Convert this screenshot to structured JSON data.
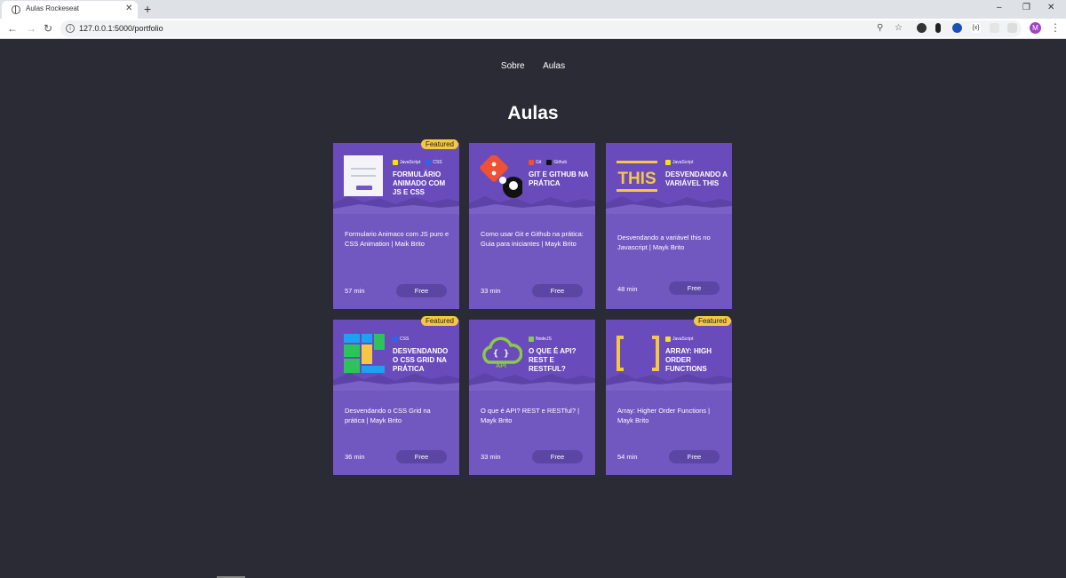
{
  "browser": {
    "tab_title": "Aulas Rockeseat",
    "url": "127.0.0.1:5000/portfolio",
    "avatar_letter": "M",
    "window_controls": [
      "–",
      "❐",
      "✕"
    ]
  },
  "nav": {
    "links": [
      "Sobre",
      "Aulas"
    ]
  },
  "page_title": "Aulas",
  "colors": {
    "background": "#2a2b35",
    "card": "#7157c0",
    "thumb": "#6a4bbb",
    "badge": "#f5c843",
    "price_pill": "#5b46a4"
  },
  "cards": [
    {
      "featured": "Featured",
      "tags": [
        {
          "label": "JavaScript",
          "color": "#f7df1e"
        },
        {
          "label": "CSS",
          "color": "#2965f1"
        }
      ],
      "thumb_title": "Formulário animado com JS e CSS",
      "art": "form",
      "description": "Formulario Animaco com JS puro e CSS Animation | Maik Brito",
      "duration": "57 min",
      "price": "Free"
    },
    {
      "featured": "",
      "tags": [
        {
          "label": "Git",
          "color": "#f05033"
        },
        {
          "label": "Github",
          "color": "#111111"
        }
      ],
      "thumb_title": "Git e Github na prática",
      "art": "git",
      "description": "Como usar Git e Github na prática: Guia para iniciantes | Mayk Brito",
      "duration": "33 min",
      "price": "Free"
    },
    {
      "featured": "",
      "tags": [
        {
          "label": "JavaScript",
          "color": "#f7df1e"
        }
      ],
      "thumb_title": "Desvendando a variável this",
      "art": "this",
      "description": "Desvendando a variável this no Javascript | Mayk Brito",
      "duration": "48 min",
      "price": "Free"
    },
    {
      "featured": "Featured",
      "tags": [
        {
          "label": "CSS",
          "color": "#2965f1"
        }
      ],
      "thumb_title": "Desvendando o CSS Grid na prática",
      "art": "grid",
      "description": "Desvendando o CSS Grid na prática | Mayk Brito",
      "duration": "36 min",
      "price": "Free"
    },
    {
      "featured": "",
      "tags": [
        {
          "label": "NodeJS",
          "color": "#8cc84b"
        }
      ],
      "thumb_title": "O que é API? REST e RESTful?",
      "art": "api",
      "description": "O que é API? REST e RESTful? | Mayk Brito",
      "duration": "33 min",
      "price": "Free"
    },
    {
      "featured": "Featured",
      "tags": [
        {
          "label": "JavaScript",
          "color": "#f7df1e"
        }
      ],
      "thumb_title": "Array: High Order Functions",
      "art": "array",
      "description": "Array: Higher Order Functions | Mayk Brito",
      "duration": "54 min",
      "price": "Free"
    }
  ]
}
